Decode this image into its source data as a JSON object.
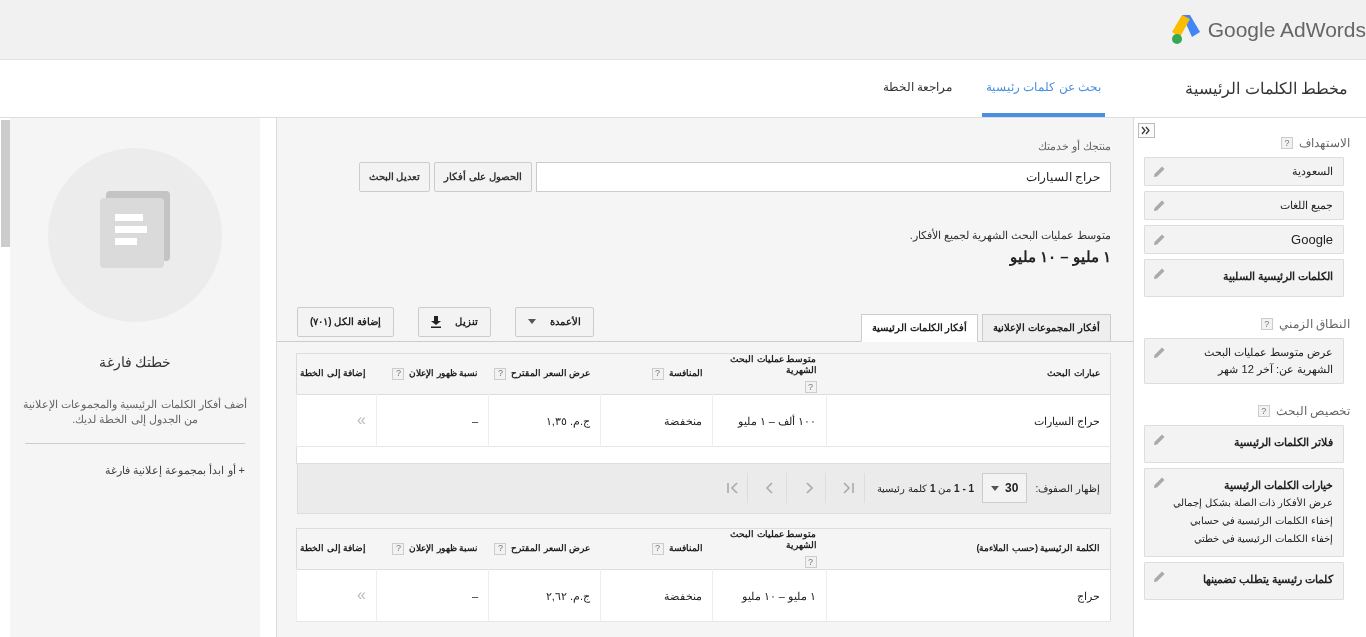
{
  "header": {
    "logo_text": "Google AdWords"
  },
  "nav": {
    "title": "مخطط الكلمات الرئيسية",
    "tabs": [
      {
        "label": "بحث عن كلمات رئيسية",
        "selected": true
      },
      {
        "label": "مراجعة الخطة",
        "selected": false
      }
    ]
  },
  "sidebar": {
    "sections": [
      {
        "heading": "الاستهداف",
        "help": "?",
        "items": [
          {
            "kind": "value",
            "title": "السعودية"
          },
          {
            "kind": "value",
            "title": "جميع اللغات"
          },
          {
            "kind": "value",
            "title": "Google"
          },
          {
            "kind": "heading",
            "title": "الكلمات الرئيسية السلبية"
          }
        ]
      },
      {
        "heading": "النطاق الزمني",
        "help": "?",
        "items": [
          {
            "kind": "value",
            "title": "عرض متوسط عمليات البحث الشهرية عن: آخر 12 شهر"
          }
        ]
      },
      {
        "heading": "تخصيص البحث",
        "help": "?",
        "items": [
          {
            "kind": "heading",
            "title": "فلاتر الكلمات الرئيسية"
          },
          {
            "kind": "heading",
            "title": "خيارات الكلمات الرئيسية",
            "lines": [
              "عرض الأفكار ذات الصلة بشكل إجمالي",
              "إخفاء الكلمات الرئيسية في حسابي",
              "إخفاء الكلمات الرئيسية في خطتي"
            ]
          },
          {
            "kind": "heading",
            "title": "كلمات رئيسية يتطلب تضمينها"
          }
        ]
      }
    ]
  },
  "search": {
    "label": "منتجك أو خدمتك",
    "value": "حراج السيارات",
    "buttons": [
      "الحصول على أفكار",
      "تعديل البحث"
    ]
  },
  "summary": {
    "label": "متوسط عمليات البحث الشهرية لجميع الأفكار.",
    "value": "١ مليو – ١٠ مليو"
  },
  "result_tabs": [
    {
      "label": "أفكار المجموعات الإعلانية",
      "selected": false
    },
    {
      "label": "أفكار الكلمات الرئيسية",
      "selected": true
    }
  ],
  "toolbar": [
    {
      "kind": "dropdown",
      "label": "الأعمدة"
    },
    {
      "kind": "download",
      "label": "تنزيل"
    },
    {
      "kind": "plain",
      "label": "إضافة الكل (٧٠١)"
    }
  ],
  "search_terms_table": {
    "columns": [
      {
        "label": "عبارات البحث"
      },
      {
        "label": "متوسط عمليات البحث الشهرية",
        "help": "?"
      },
      {
        "label": "المنافسة",
        "help": "?"
      },
      {
        "label": "عرض السعر المقترح",
        "help": "?"
      },
      {
        "label": "نسبة ظهور الإعلان",
        "help": "?"
      },
      {
        "label": "إضافة إلى الخطة"
      }
    ],
    "rows": [
      [
        "حراج السيارات",
        "١٠٠ ألف – ١ مليو",
        "منخفضة",
        "ج.م. ١,٣٥",
        "–",
        "»"
      ]
    ]
  },
  "pagination": {
    "rows_label": "إظهار الصفوف:",
    "page_size": "30",
    "range": "**1 - 1** من **1** كلمة رئيسية"
  },
  "keywords_table": {
    "columns": [
      {
        "label": "الكلمة الرئيسية (حسب الملاءمة)"
      },
      {
        "label": "متوسط عمليات البحث الشهرية",
        "help": "?"
      },
      {
        "label": "المنافسة",
        "help": "?"
      },
      {
        "label": "عرض السعر المقترح",
        "help": "?"
      },
      {
        "label": "نسبة ظهور الإعلان",
        "help": "?"
      },
      {
        "label": "إضافة إلى الخطة"
      }
    ],
    "rows": [
      [
        "حراج",
        "١ مليو – ١٠ مليو",
        "منخفضة",
        "ج.م. ٢,٦٢",
        "–",
        "»"
      ]
    ]
  },
  "plan": {
    "title": "خطتك فارغة",
    "description": "أضف أفكار الكلمات الرئيسية والمجموعات الإعلانية من الجدول إلى الخطة لديك.",
    "link": "+ أو ابدأ بمجموعة إعلانية فارغة"
  }
}
